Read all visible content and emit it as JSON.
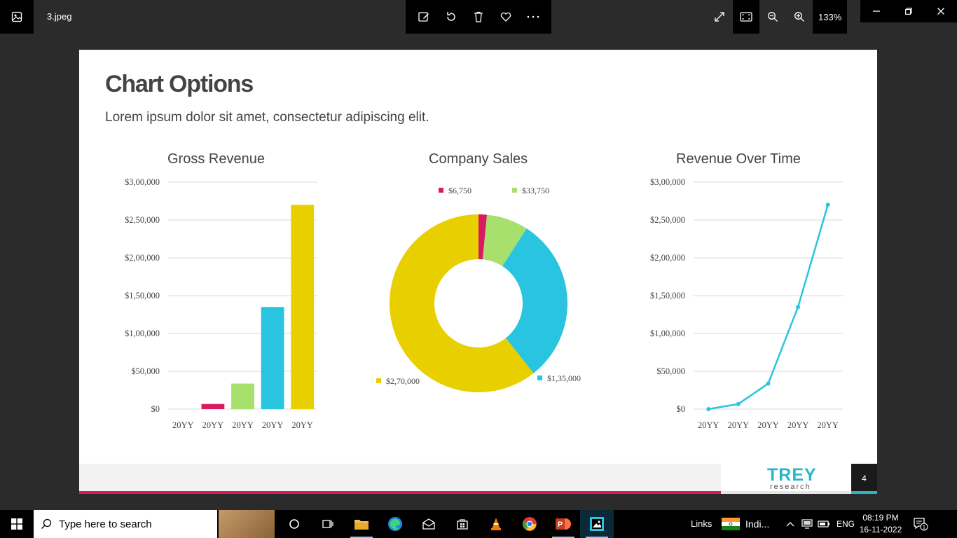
{
  "viewer": {
    "file_name": "3.jpeg",
    "zoom_level": "133%"
  },
  "slide": {
    "title": "Chart Options",
    "subtitle": "Lorem ipsum dolor sit amet, consectetur adipiscing elit.",
    "logo_main": "TREY",
    "logo_sub": "research",
    "page_number": "4"
  },
  "chart_data": [
    {
      "type": "bar",
      "title": "Gross Revenue",
      "categories": [
        "20YY",
        "20YY",
        "20YY",
        "20YY",
        "20YY"
      ],
      "values": [
        0,
        6750,
        33750,
        135000,
        270000
      ],
      "colors": [
        "#d81b60",
        "#d81b60",
        "#a8e06e",
        "#29c4e0",
        "#e8d000"
      ],
      "ylim": [
        0,
        300000
      ],
      "yticks": [
        0,
        50000,
        100000,
        150000,
        200000,
        250000,
        300000
      ],
      "ytick_labels": [
        "$0",
        "$50,000",
        "$1,00,000",
        "$1,50,000",
        "$2,00,000",
        "$2,50,000",
        "$3,00,000"
      ],
      "grid": true
    },
    {
      "type": "pie",
      "title": "Company Sales",
      "labels": [
        "$6,750",
        "$33,750",
        "$1,35,000",
        "$2,70,000"
      ],
      "values": [
        6750,
        33750,
        135000,
        270000
      ],
      "colors": [
        "#d81b60",
        "#a8e06e",
        "#29c4e0",
        "#e8d000"
      ],
      "donut": true
    },
    {
      "type": "line",
      "title": "Revenue Over Time",
      "categories": [
        "20YY",
        "20YY",
        "20YY",
        "20YY",
        "20YY"
      ],
      "values": [
        0,
        6750,
        33750,
        135000,
        270000
      ],
      "color": "#29c4e0",
      "ylim": [
        0,
        300000
      ],
      "yticks": [
        0,
        50000,
        100000,
        150000,
        200000,
        250000,
        300000
      ],
      "ytick_labels": [
        "$0",
        "$50,000",
        "$1,00,000",
        "$1,50,000",
        "$2,00,000",
        "$2,50,000",
        "$3,00,000"
      ],
      "grid": true
    }
  ],
  "taskbar": {
    "search_placeholder": "Type here to search",
    "links_label": "Links",
    "news_label": "Indi...",
    "language": "ENG",
    "time": "08:19 PM",
    "date": "16-11-2022",
    "notification_count": "1"
  }
}
